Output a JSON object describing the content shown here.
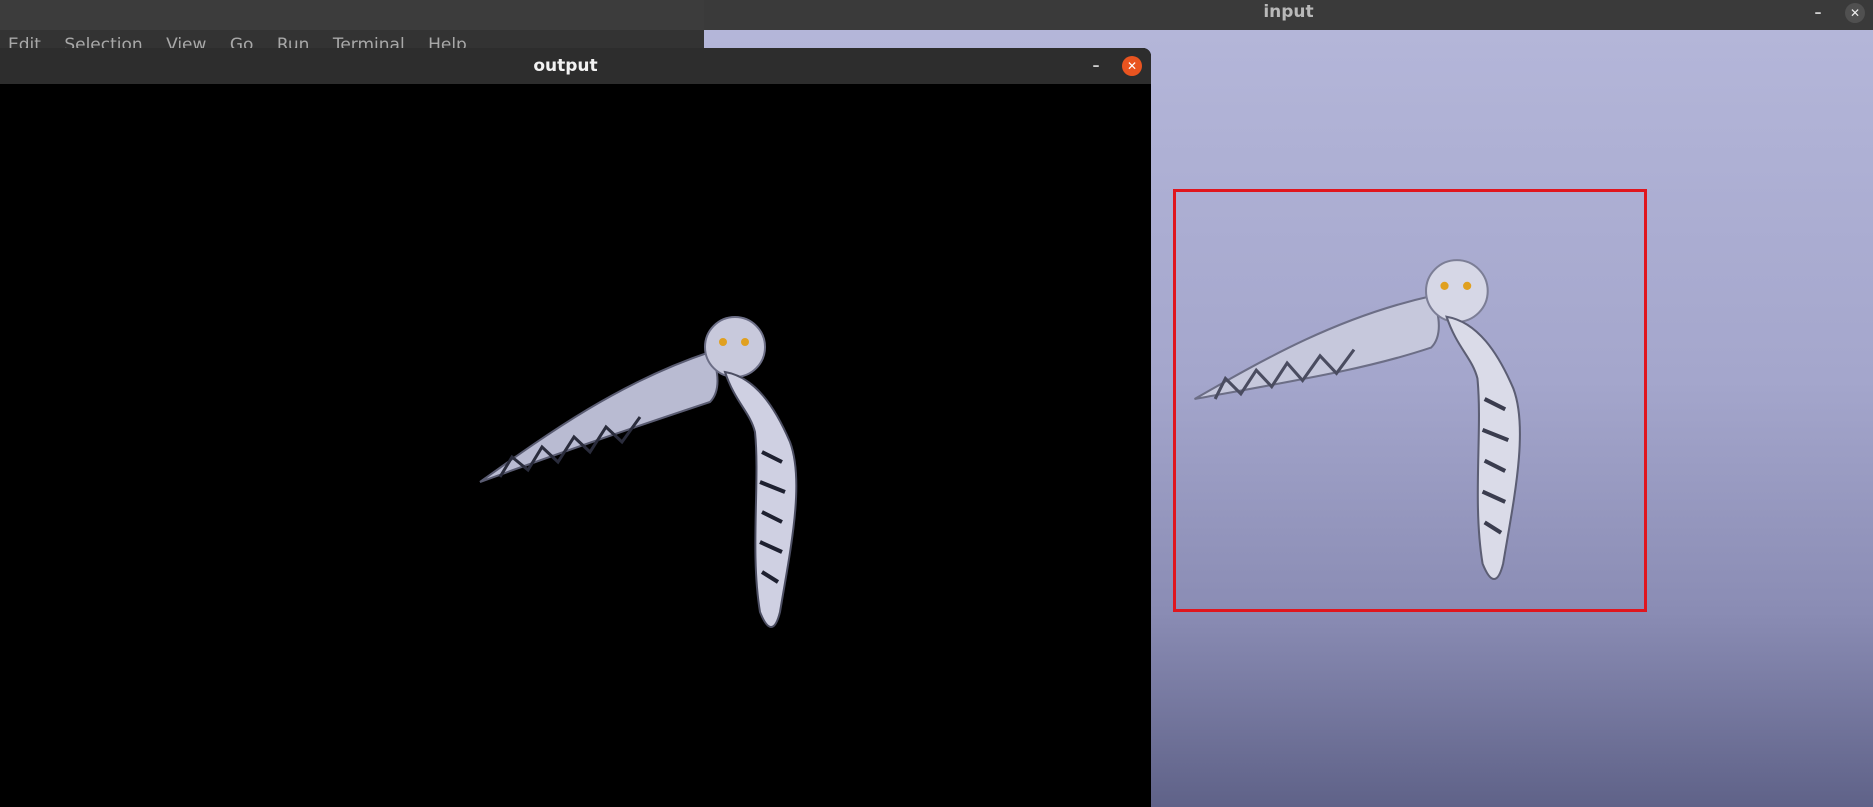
{
  "editor": {
    "menu": [
      "Edit",
      "Selection",
      "View",
      "Go",
      "Run",
      "Terminal",
      "Help"
    ]
  },
  "input_window": {
    "title": "input",
    "minimize_glyph": "–",
    "close_glyph": "✕",
    "bbox_color": "#e0161e"
  },
  "output_window": {
    "title": "output",
    "minimize_glyph": "–",
    "close_glyph": "✕",
    "close_color": "#e95420"
  },
  "icons": {
    "minimize": "minimize-icon",
    "close": "close-icon",
    "subject": "snowy-owl-image"
  }
}
